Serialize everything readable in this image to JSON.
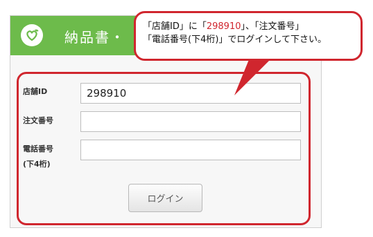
{
  "header": {
    "logo_icon": "leaf-heart-icon",
    "title": "納品書・"
  },
  "form": {
    "store_id_label": "店舗ID",
    "store_id_value": "298910",
    "order_no_label": "注文番号",
    "order_no_value": "",
    "phone_label_line1": "電話番号",
    "phone_label_line2": "(下4桁)",
    "phone_value": "",
    "login_label": "ログイン"
  },
  "callout": {
    "line1_pre": "「店舗ID」に「",
    "line1_highlight": "298910",
    "line1_post": "」、「注文番号」",
    "line2": "「電話番号(下4桁)」でログインして下さい。"
  },
  "colors": {
    "header_green": "#6dbb4b",
    "highlight_red": "#d0262e"
  }
}
